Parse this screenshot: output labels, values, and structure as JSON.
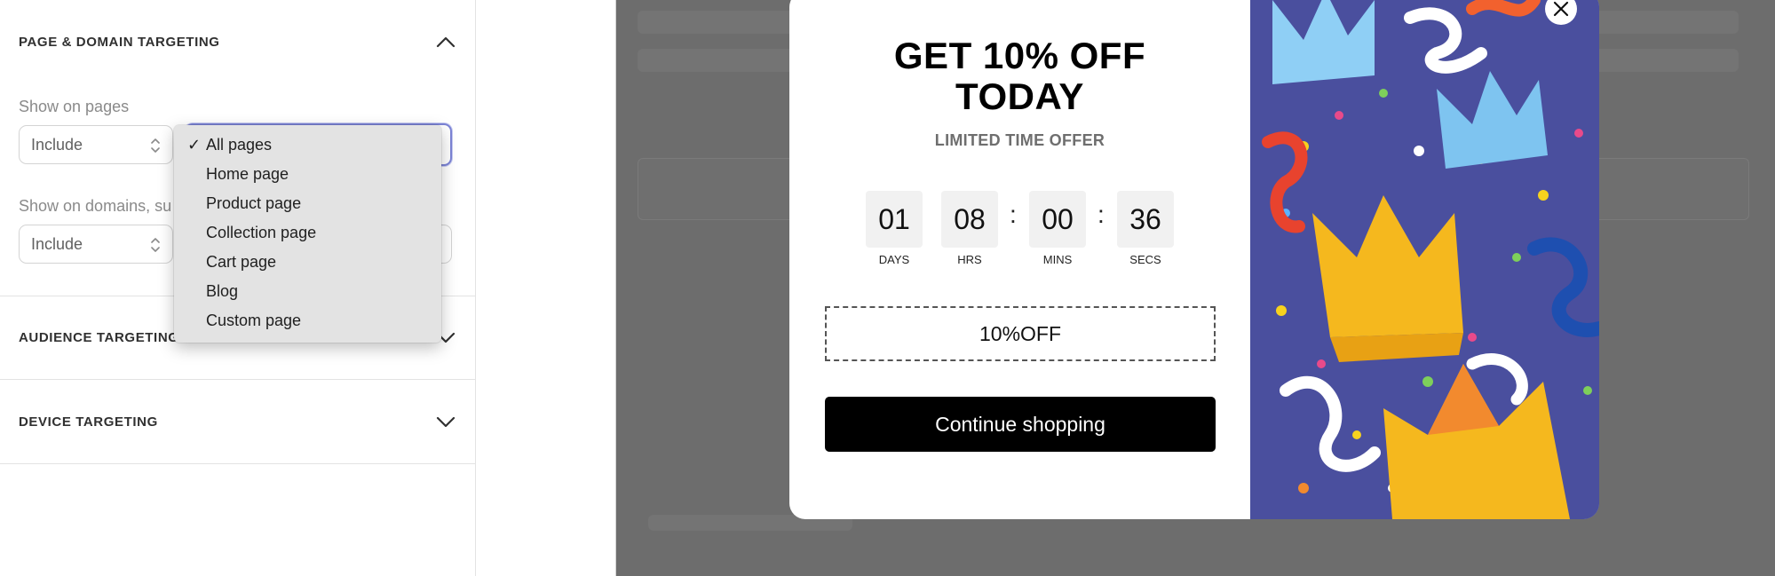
{
  "settings": {
    "page_domain_targeting": {
      "title": "PAGE & DOMAIN TARGETING",
      "show_on_pages_label": "Show on pages",
      "pages_mode": "Include",
      "show_on_domains_label": "Show on domains, su",
      "domains_mode": "Include"
    },
    "audience_targeting": {
      "title": "AUDIENCE TARGETING"
    },
    "device_targeting": {
      "title": "DEVICE TARGETING"
    }
  },
  "pages_dropdown": {
    "check_mark": "✓",
    "options": [
      "All pages",
      "Home page",
      "Product page",
      "Collection page",
      "Cart page",
      "Blog",
      "Custom page"
    ],
    "selected": "All pages"
  },
  "popup": {
    "headline_line1": "GET 10% OFF",
    "headline_line2": "TODAY",
    "subhead": "LIMITED TIME OFFER",
    "countdown": {
      "days": "01",
      "hours": "08",
      "mins": "00",
      "secs": "36",
      "days_label": "DAYS",
      "hours_label": "HRS",
      "mins_label": "MINS",
      "secs_label": "SECS",
      "separator": ":"
    },
    "coupon_code": "10%OFF",
    "cta_label": "Continue shopping",
    "image_icon": "party-crowns-image"
  },
  "colors": {
    "overlay": "#6d6d6d",
    "cta_bg": "#000000",
    "focus_ring": "#7c84d6",
    "image_bg": "#4a4f9e"
  }
}
